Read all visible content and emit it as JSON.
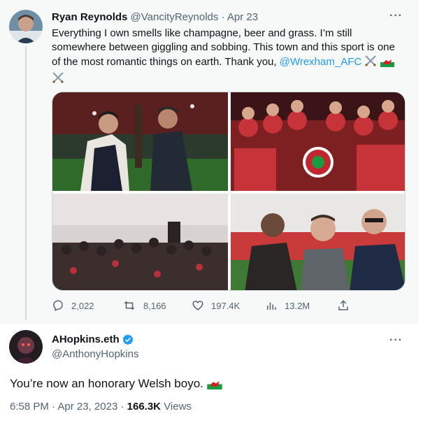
{
  "parent_tweet": {
    "name": "Ryan Reynolds",
    "handle": "@VancityReynolds",
    "separator": "·",
    "date": "Apr 23",
    "text_before": "Everything I own smells like champagne, beer and grass. I’m still somewhere between giggling and sobbing. This town and this sport is one of the most romantic things on earth. Thank you, ",
    "mention": "@Wrexham_AFC",
    "emojis": [
      "crossed-swords",
      "wales-flag",
      "crossed-swords"
    ],
    "more_label": "···",
    "media": [
      "celebration-trophy-photo",
      "team-photo-with-crest",
      "crowd-pitch-invasion-photo",
      "three-men-stadium-photo"
    ],
    "actions": {
      "replies": "2,022",
      "retweets": "8,166",
      "likes": "197.4K",
      "views": "13.2M"
    }
  },
  "reply_tweet": {
    "name": "AHopkins.eth",
    "verified": true,
    "handle": "@AnthonyHopkins",
    "text": "You’re now an honorary Welsh boyo.",
    "text_emoji": "wales-flag",
    "time": "6:58 PM",
    "date": "Apr 23, 2023",
    "separator": "·",
    "views_count": "166.3K",
    "views_label": "Views",
    "more_label": "···"
  },
  "colors": {
    "accent": "#1d9bf0",
    "muted": "#536471",
    "text": "#0f1419",
    "parent_bg": "#f7f9f9"
  }
}
